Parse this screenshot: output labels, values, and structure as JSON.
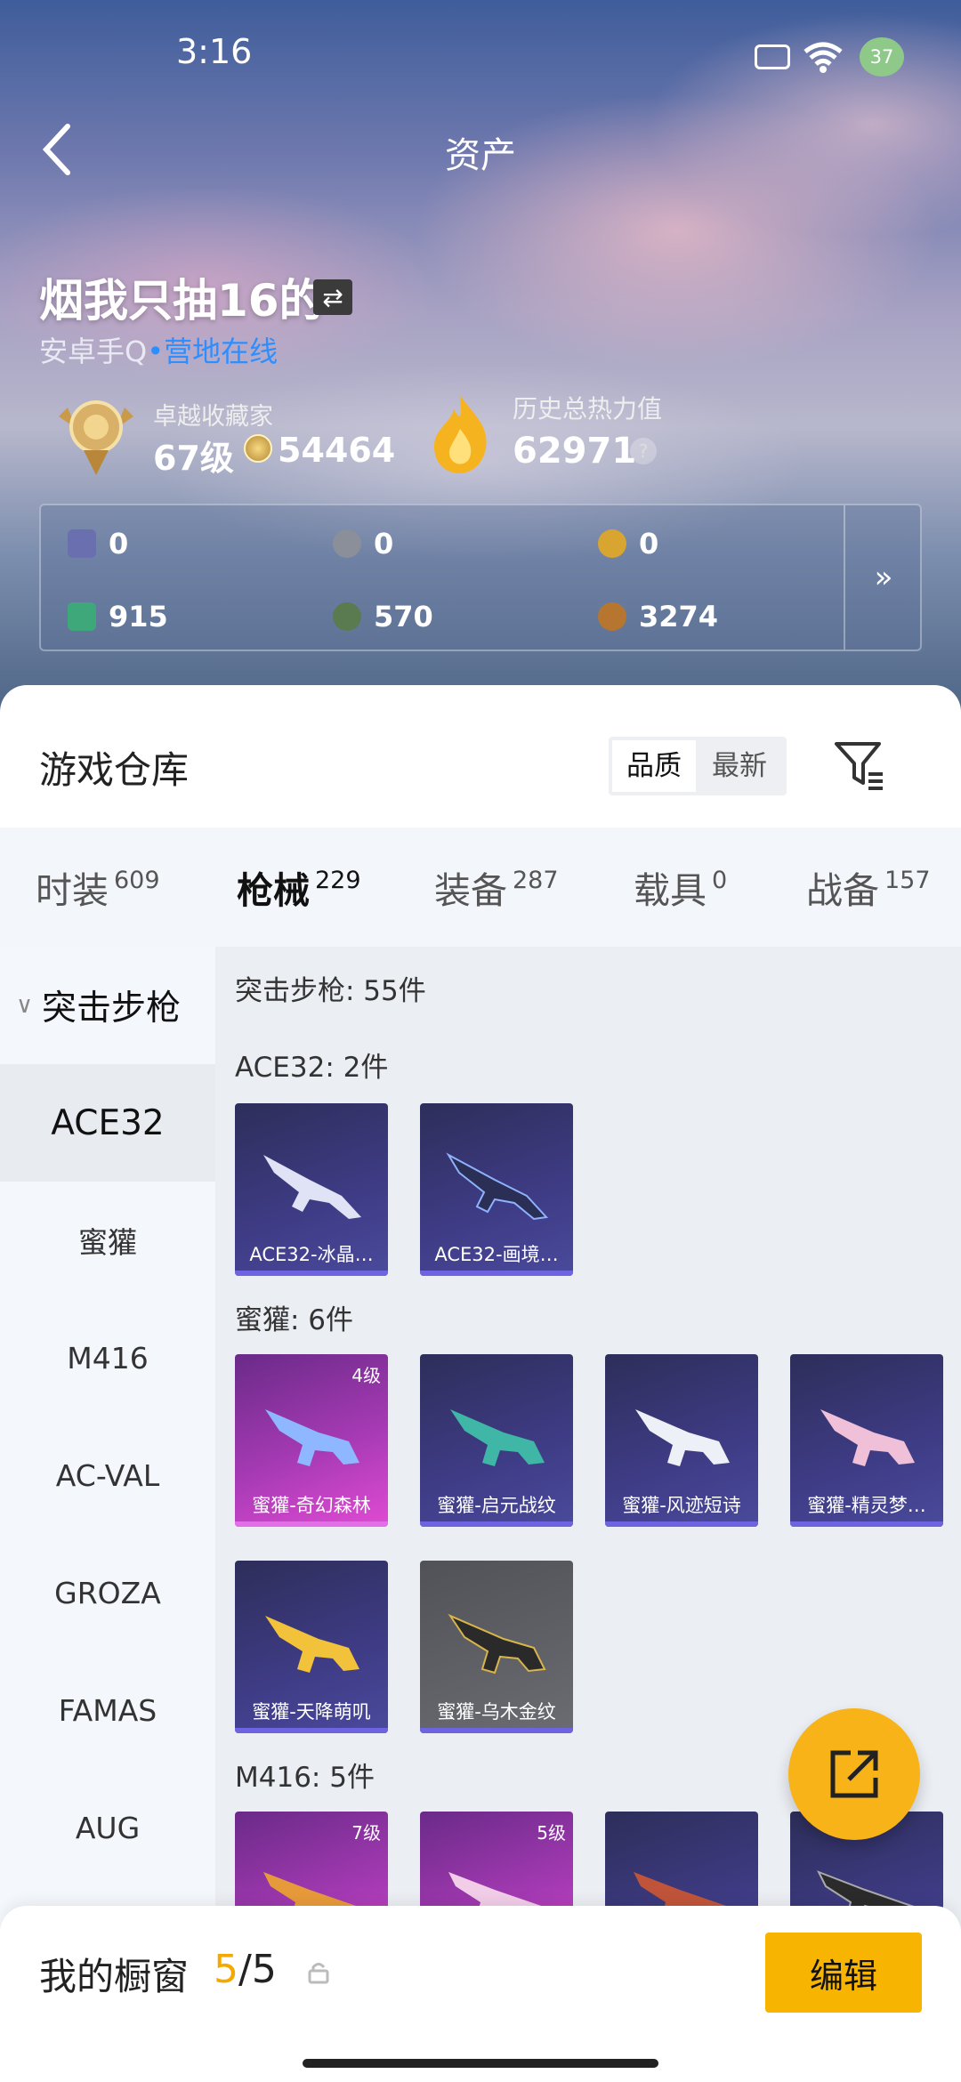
{
  "status_bar": {
    "time": "3:16",
    "battery": "37",
    "wifi_label": "6"
  },
  "header": {
    "title": "资产"
  },
  "profile": {
    "username": "烟我只抽16的",
    "platform": "安卓手Q",
    "online_status": "营地在线",
    "rank_title": "卓越收藏家",
    "level": "67级",
    "coins": "54464",
    "heat_label": "历史总热力值",
    "heat_value": "62971",
    "help_icon": "?"
  },
  "resources": {
    "items": [
      {
        "icon": "card-icon",
        "value": "0",
        "color": "#6a6fb0"
      },
      {
        "icon": "coin-gray-icon",
        "value": "0",
        "color": "#8a8f9a"
      },
      {
        "icon": "coin-gold-icon",
        "value": "0",
        "color": "#d8a630"
      },
      {
        "icon": "card-green-icon",
        "value": "915",
        "color": "#3fa87a"
      },
      {
        "icon": "orb-green-icon",
        "value": "570",
        "color": "#5a7a50"
      },
      {
        "icon": "orb-bronze-icon",
        "value": "3274",
        "color": "#b7762f"
      }
    ],
    "more_label": "»"
  },
  "warehouse": {
    "title": "游戏仓库",
    "sort_quality": "品质",
    "sort_newest": "最新"
  },
  "tabs": [
    {
      "label": "时装",
      "count": "609"
    },
    {
      "label": "枪械",
      "count": "229",
      "active": true
    },
    {
      "label": "装备",
      "count": "287"
    },
    {
      "label": "载具",
      "count": "0"
    },
    {
      "label": "战备",
      "count": "157"
    }
  ],
  "sidebar": {
    "category": "突击步枪",
    "items": [
      "ACE32",
      "蜜獾",
      "M416",
      "AC-VAL",
      "GROZA",
      "FAMAS",
      "AUG"
    ],
    "selected": "ACE32"
  },
  "grid": {
    "summary": "突击步枪: 55件",
    "groups": [
      {
        "header": "ACE32: 2件",
        "cards": [
          {
            "name": "ACE32-冰晶…",
            "tier": "blue",
            "level": ""
          },
          {
            "name": "ACE32-画境…",
            "tier": "blue",
            "level": ""
          }
        ]
      },
      {
        "header": "蜜獾: 6件",
        "cards": [
          {
            "name": "蜜獾-奇幻森林",
            "tier": "pink",
            "level": "4级"
          },
          {
            "name": "蜜獾-启元战纹",
            "tier": "blue",
            "level": ""
          },
          {
            "name": "蜜獾-风迹短诗",
            "tier": "blue",
            "level": ""
          },
          {
            "name": "蜜獾-精灵梦…",
            "tier": "blue",
            "level": ""
          },
          {
            "name": "蜜獾-天降萌叽",
            "tier": "blue",
            "level": ""
          },
          {
            "name": "蜜獾-乌木金纹",
            "tier": "gray",
            "level": ""
          }
        ]
      },
      {
        "header": "M416: 5件",
        "cards": [
          {
            "name": "",
            "tier": "pink",
            "level": "7级"
          },
          {
            "name": "",
            "tier": "pink",
            "level": "5级"
          },
          {
            "name": "",
            "tier": "blue",
            "level": ""
          },
          {
            "name": "",
            "tier": "blue",
            "level": ""
          }
        ]
      }
    ]
  },
  "showcase": {
    "label": "我的橱窗",
    "current": "5",
    "sep": "/",
    "total": "5",
    "edit_label": "编辑"
  },
  "colors": {
    "accent": "#f7b400",
    "online": "#2d8eff",
    "pink_tier": "#e04bd3",
    "blue_tier": "#4a4a9c"
  }
}
